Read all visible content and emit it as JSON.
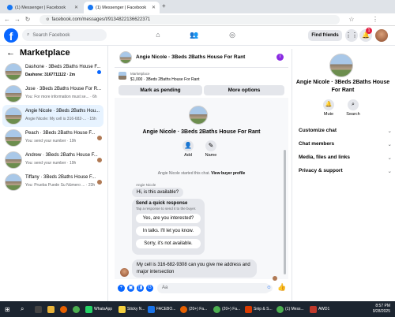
{
  "browser": {
    "tabs": [
      {
        "title": "(1) Messenger | Facebook",
        "active": false
      },
      {
        "title": "(1) Messenger | Facebook",
        "active": true
      }
    ],
    "new_tab": "+",
    "url": "facebook.com/messages/t/9134822136622371"
  },
  "header": {
    "logo": "f",
    "search_placeholder": "Search Facebook",
    "find_friends": "Find friends",
    "notification_count": "1"
  },
  "marketplace": {
    "title": "Marketplace",
    "conversations": [
      {
        "name": "Dashone · 3Beds 2Baths House F...",
        "preview": "Dashone: 3167711122 · 2m",
        "unread": true,
        "selected": false
      },
      {
        "name": "Jose · 3Beds 2Baths House For R...",
        "preview": "You: For more information must se... · 6h",
        "unread": false,
        "selected": false
      },
      {
        "name": "Angie Nicole · 3Beds 2Baths Hou...",
        "preview": "Angie Nicole: My cell is 316-682-... · 15h",
        "unread": false,
        "selected": true
      },
      {
        "name": "Peach · 3Beds 2Baths House F...",
        "preview": "You: send your number · 19h",
        "unread": false,
        "selected": false
      },
      {
        "name": "Andrew · 3Beds 2Baths House F...",
        "preview": "You: send your number · 19h",
        "unread": false,
        "selected": false
      },
      {
        "name": "Tiffany · 3Beds 2Baths House F...",
        "preview": "You: Prueba Puede Su Número ... · 23h",
        "unread": false,
        "selected": false
      }
    ]
  },
  "chat": {
    "title": "Angie Nicole · 3Beds 2Baths House For Rant",
    "listing_label": "Marketplace",
    "listing_price": "$1,000 · 3Beds 2Baths House For Rant",
    "mark_pending": "Mark as pending",
    "more_options": "More options",
    "profile_name": "Angie Nicole · 3Beds 2Baths House For Rant",
    "add_label": "Add",
    "name_label": "Name",
    "started_text": "Angie Nicole started this chat.",
    "view_profile": "View buyer profile",
    "sender": "Angie Nicole",
    "first_msg": "Hi, is this available?",
    "quick_title": "Send a quick response",
    "quick_sub": "Tap a response to send it to the buyer.",
    "quick_options": [
      "Yes, are you interested?",
      "In talks. I'll let you know.",
      "Sorry, it's not available."
    ],
    "last_msg": "My cell is 316-682-9308 can you give me address and major intersection",
    "composer_placeholder": "Aa"
  },
  "details": {
    "name": "Angie Nicole · 3Beds 2Baths House For Rant",
    "mute": "Mute",
    "search": "Search",
    "sections": [
      "Customize chat",
      "Chat members",
      "Media, files and links",
      "Privacy & support"
    ]
  },
  "taskbar": {
    "items": [
      "WhatsApp",
      "Sticky N...",
      "FACEBO...",
      "(20+) Fa...",
      "(20+) Fa...",
      "Snip & S...",
      "(1) Mess...",
      "AWD1"
    ],
    "time": "8:57 PM",
    "date": "9/28/2025"
  },
  "colors": {
    "accent": "#0866ff",
    "badge": "#e41e3f",
    "taskbar": "#1c2530"
  }
}
